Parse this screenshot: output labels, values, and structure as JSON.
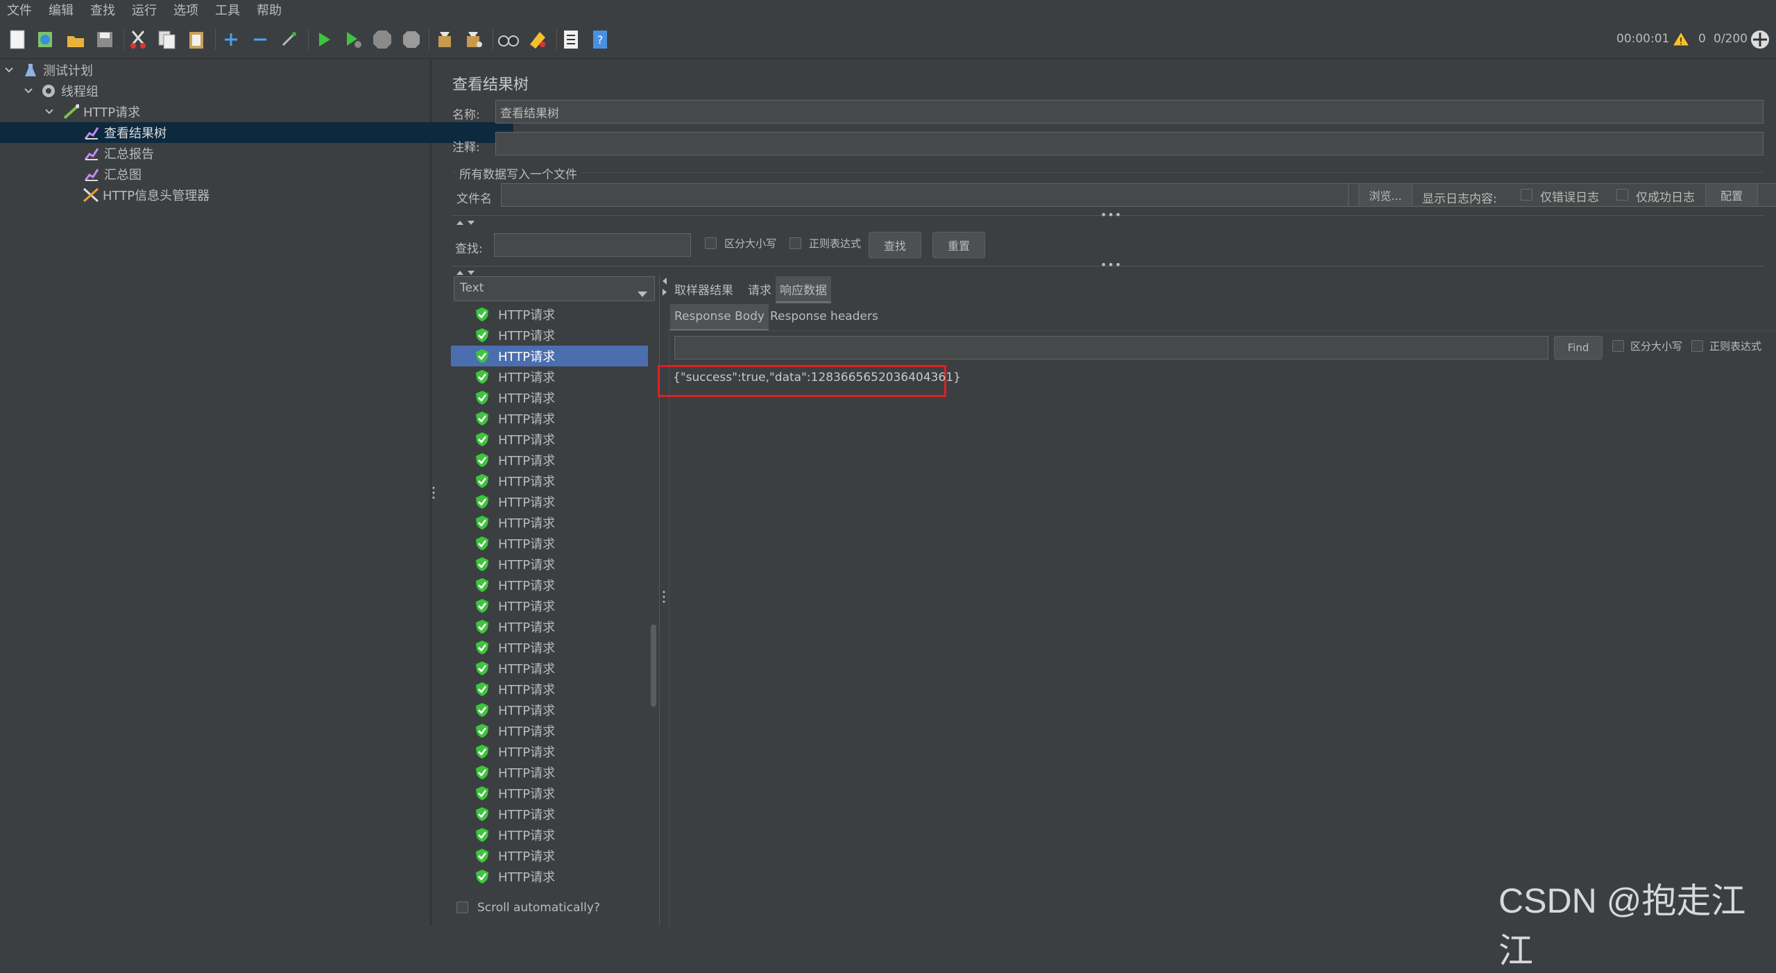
{
  "menu": [
    "文件",
    "编辑",
    "查找",
    "运行",
    "选项",
    "工具",
    "帮助"
  ],
  "toolbar": {
    "icons": [
      "new-icon",
      "templates-icon",
      "open-icon",
      "save-icon",
      "cut-icon",
      "copy-icon",
      "paste-icon",
      "expand-icon",
      "collapse-icon",
      "toggle-icon",
      "start-icon",
      "start-no-pause-icon",
      "stop-icon",
      "shutdown-icon",
      "clear-icon",
      "clear-all-icon",
      "search-icon",
      "reset-search-icon",
      "function-helper-icon",
      "help-icon"
    ],
    "timer": "00:00:01",
    "warning_count": "0",
    "threads": "0/200"
  },
  "tree": {
    "items": [
      {
        "label": "测试计划",
        "icon": "test-plan-icon",
        "level": 0,
        "expanded": true
      },
      {
        "label": "线程组",
        "icon": "thread-group-icon",
        "level": 1,
        "expanded": true
      },
      {
        "label": "HTTP请求",
        "icon": "http-sampler-icon",
        "level": 2,
        "expanded": true
      },
      {
        "label": "查看结果树",
        "icon": "listener-icon",
        "level": 3,
        "selected": true
      },
      {
        "label": "汇总报告",
        "icon": "listener-icon",
        "level": 3
      },
      {
        "label": "汇总图",
        "icon": "listener-icon",
        "level": 3
      },
      {
        "label": "HTTP信息头管理器",
        "icon": "config-tools-icon",
        "level": 3
      }
    ]
  },
  "panel": {
    "title": "查看结果树",
    "name_label": "名称:",
    "name_value": "查看结果树",
    "comment_label": "注释:",
    "comment_value": "",
    "file_section_label": "所有数据写入一个文件",
    "filename_label": "文件名",
    "filename_value": "",
    "browse_label": "浏览...",
    "log_display_label": "显示日志内容:",
    "errors_only_label": "仅错误日志",
    "success_only_label": "仅成功日志",
    "configure_label": "配置",
    "search_label": "查找:",
    "search_value": "",
    "case_sensitive_label": "区分大小写",
    "regex_label": "正则表达式",
    "find_label": "查找",
    "reset_label": "重置"
  },
  "results": {
    "renderer": "Text",
    "item_label": "HTTP请求",
    "item_count": 28,
    "selected_index": 2,
    "scroll_auto_label": "Scroll automatically?"
  },
  "response": {
    "tabs": [
      "取样器结果",
      "请求",
      "响应数据"
    ],
    "active_tab": "响应数据",
    "subtabs": [
      "Response Body",
      "Response headers"
    ],
    "active_subtab": "Response Body",
    "find_label": "Find",
    "case_sensitive_label": "区分大小写",
    "regex_label": "正则表达式",
    "body": "{\"success\":true,\"data\":1283665652036404361}"
  },
  "watermark": "CSDN @抱走江江",
  "colors": {
    "background": "#3c3f41",
    "selected_tree": "#0d293e",
    "selected_result": "#4b6eaf",
    "highlight_box": "#e02020",
    "success_green": "#3ec43e"
  }
}
